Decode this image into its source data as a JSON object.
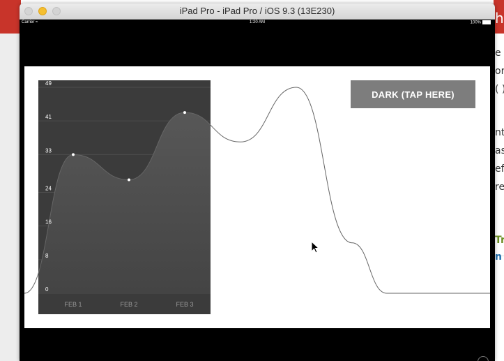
{
  "window": {
    "title": "iPad Pro - iPad Pro / iOS 9.3 (13E230)"
  },
  "status_bar": {
    "carrier": "Carrier",
    "time": "1:20 AM",
    "battery": "100%"
  },
  "button": {
    "label": "DARK (TAP HERE)"
  },
  "background_page": {
    "header_fragment": "h",
    "text_fragments": [
      "e s",
      "or",
      "( )",
      "nt",
      "as",
      "ef",
      "rep"
    ],
    "link_fragments": [
      "Tr",
      "n"
    ],
    "link_colors": [
      "#6b8e23",
      "#1f6fae"
    ]
  },
  "colors": {
    "panel": "#3b3b3b",
    "button": "#7d7d7d",
    "line": "#666666",
    "point": "#ffffff",
    "traffic_min": "#f5bf30"
  },
  "chart_data": {
    "type": "area",
    "title": "",
    "xlabel": "",
    "ylabel": "",
    "x_ticks": [
      "FEB 1",
      "FEB 2",
      "FEB 3"
    ],
    "y_ticks": [
      0,
      8,
      16,
      24,
      33,
      41,
      49
    ],
    "ylim": [
      0,
      49
    ],
    "grid": true,
    "series": [
      {
        "values": [
          0,
          33,
          27,
          43,
          36,
          49,
          12,
          0,
          0
        ],
        "highlighted_points": [
          1,
          2,
          3
        ],
        "fill": true
      }
    ]
  }
}
